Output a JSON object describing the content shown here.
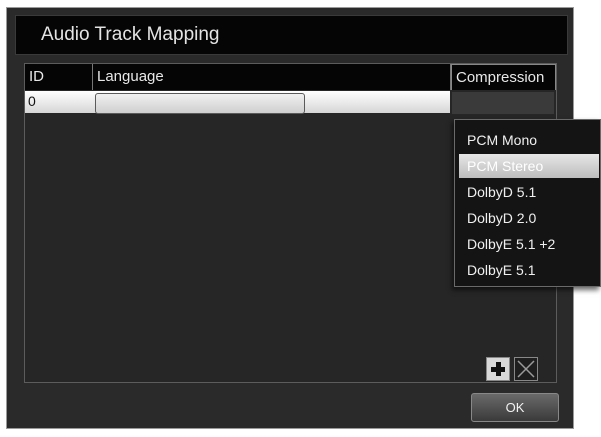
{
  "dialog": {
    "title": "Audio Track Mapping",
    "ok_label": "OK"
  },
  "table": {
    "columns": {
      "id": "ID",
      "language": "Language",
      "compression": "Compression"
    },
    "rows": [
      {
        "id": "0",
        "language": "",
        "compression": ""
      }
    ]
  },
  "compression_menu": {
    "items": [
      "PCM Mono",
      "PCM Stereo",
      "DolbyD 5.1",
      "DolbyD 2.0",
      "DolbyE 5.1 +2",
      "DolbyE 5.1"
    ],
    "highlighted": "PCM Stereo"
  },
  "icons": {
    "add": "plus-icon",
    "remove": "close-x-icon"
  }
}
